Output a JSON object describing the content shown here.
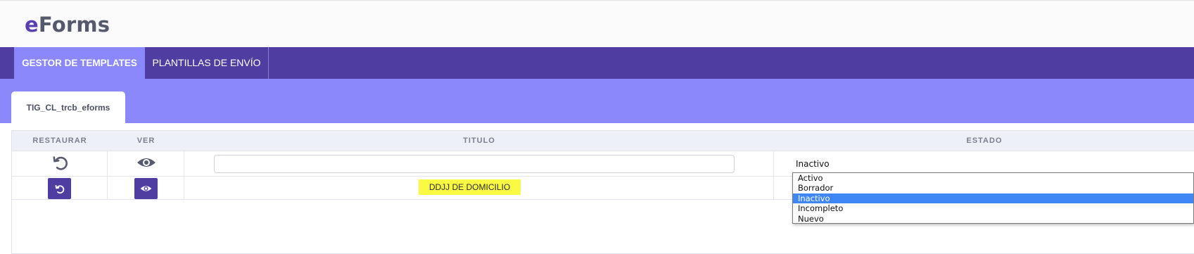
{
  "app": {
    "logo_prefix": "e",
    "logo_suffix": "Forms",
    "accent": "#4f3da1",
    "tab_bg": "#8a88fb"
  },
  "nav": {
    "tabs": [
      {
        "label": "GESTOR DE TEMPLATES",
        "active": true
      },
      {
        "label": "PLANTILLAS DE ENVÍO",
        "active": false
      }
    ]
  },
  "subtab": {
    "label": "TIG_CL_trcb_eforms"
  },
  "table": {
    "headers": {
      "restaurar": "RESTAURAR",
      "ver": "VER",
      "titulo": "TITULO",
      "estado": "ESTADO"
    },
    "filter": {
      "restore_icon": "undo-icon",
      "view_icon": "eye-icon",
      "titulo_value": "",
      "estado_value": "Inactivo"
    },
    "rows": [
      {
        "titulo": "DDJJ DE DOMICILIO",
        "highlight": "#fafa45"
      }
    ]
  },
  "estado_dropdown": {
    "options": [
      "Activo",
      "Borrador",
      "Inactivo",
      "Incompleto",
      "Nuevo"
    ],
    "selected": "Inactivo",
    "highlight_color": "#3f87f4"
  }
}
